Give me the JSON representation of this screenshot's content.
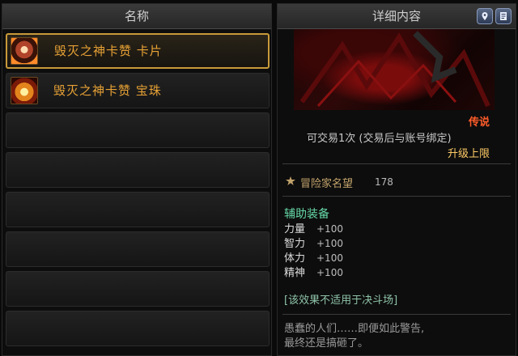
{
  "left": {
    "header": "名称",
    "items": [
      {
        "name": "毁灭之神卡赞  卡片",
        "icon": "card-icon"
      },
      {
        "name": "毁灭之神卡赞  宝珠",
        "icon": "orb-icon"
      }
    ]
  },
  "right": {
    "header": "详细内容",
    "rarity": "传说",
    "trade": "可交易1次 (交易后与账号绑定)",
    "upgrade": "升级上限",
    "fame_label": "冒险家名望",
    "fame_value": "178",
    "category": "辅助装备",
    "stats": [
      {
        "name": "力量",
        "value": "+100"
      },
      {
        "name": "智力",
        "value": "+100"
      },
      {
        "name": "体力",
        "value": "+100"
      },
      {
        "name": "精神",
        "value": "+100"
      }
    ],
    "note": "[该效果不适用于决斗场]",
    "flavor_1": "愚蠢的人们……即便如此警告,",
    "flavor_2": "最终还是搞砸了。"
  },
  "colors": {
    "selected_border": "#c89a3a",
    "item_name": "#e8a235",
    "legendary": "#ff5c2a",
    "category_green": "#66d9a8"
  },
  "icons": [
    "map-pin-icon",
    "document-icon",
    "card-icon",
    "orb-icon",
    "fame-icon"
  ]
}
